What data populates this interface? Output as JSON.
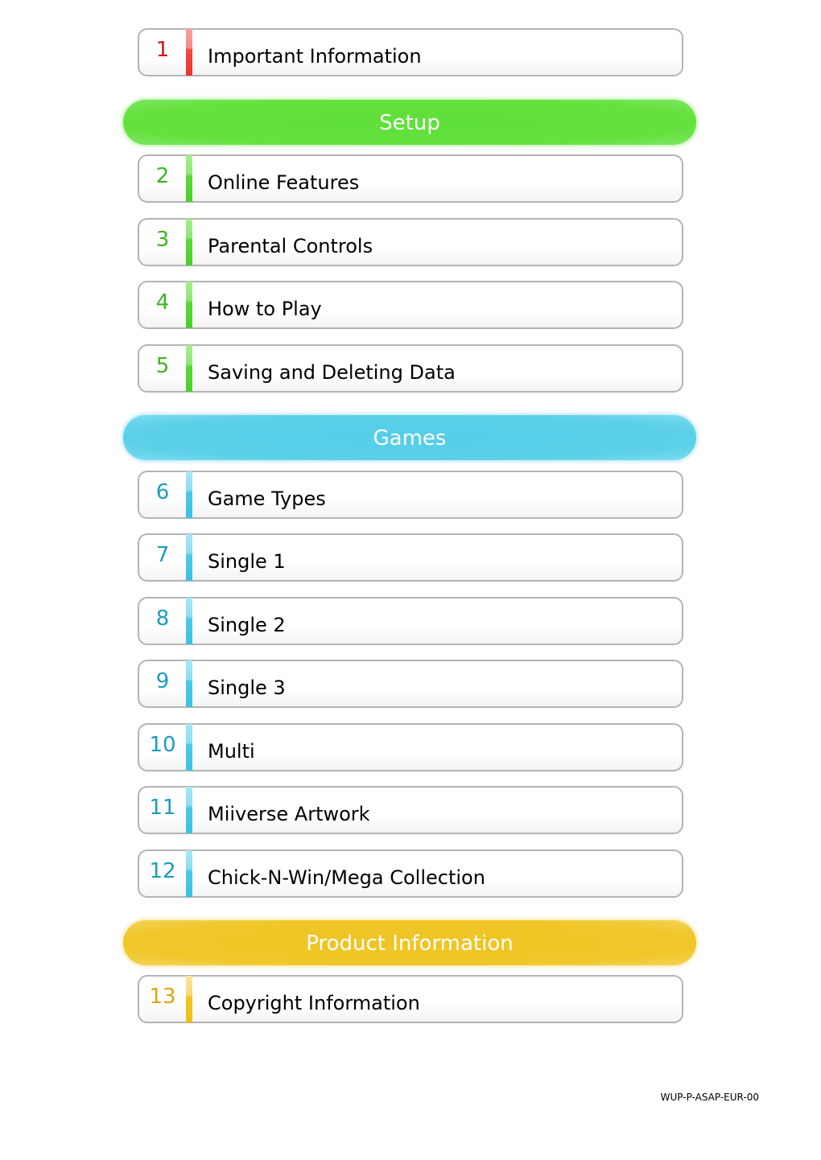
{
  "document": {
    "toc": {
      "top_item": {
        "number": "1",
        "label": "Important Information",
        "color": "#e9352f"
      },
      "sections": [
        {
          "title": "Setup",
          "color": "#64e13c",
          "items": [
            {
              "number": "2",
              "label": "Online Features"
            },
            {
              "number": "3",
              "label": "Parental Controls"
            },
            {
              "number": "4",
              "label": "How to Play"
            },
            {
              "number": "5",
              "label": "Saving and Deleting Data"
            }
          ]
        },
        {
          "title": "Games",
          "color": "#5bd0e8",
          "items": [
            {
              "number": "6",
              "label": "Game Types"
            },
            {
              "number": "7",
              "label": "Single 1"
            },
            {
              "number": "8",
              "label": "Single 2"
            },
            {
              "number": "9",
              "label": "Single 3"
            },
            {
              "number": "10",
              "label": "Multi"
            },
            {
              "number": "11",
              "label": "Miiverse Artwork"
            },
            {
              "number": "12",
              "label": "Chick-N-Win/Mega Collection"
            }
          ]
        },
        {
          "title": "Product Information",
          "color": "#f0c629",
          "items": [
            {
              "number": "13",
              "label": "Copyright Information"
            }
          ]
        }
      ]
    },
    "footer_code": "WUP-P-ASAP-EUR-00"
  }
}
